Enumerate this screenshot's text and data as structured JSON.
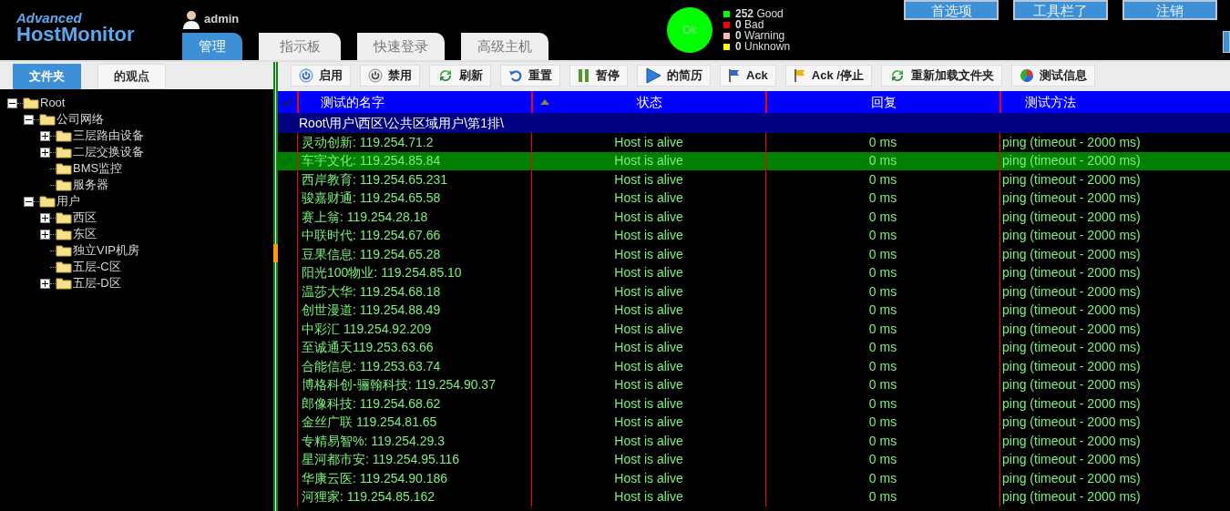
{
  "logo": {
    "line1": "Advanced",
    "line2": "HostMonitor"
  },
  "user": "admin",
  "tabs": [
    {
      "label": "管理",
      "selected": true
    },
    {
      "label": "指示板",
      "selected": false
    },
    {
      "label": "快速登录",
      "selected": false
    },
    {
      "label": "高级主机",
      "selected": false
    }
  ],
  "status_light": {
    "label": "Ok",
    "color": "#00ff00"
  },
  "summary": [
    {
      "count": "252",
      "label": "Good",
      "color": "#00ff00"
    },
    {
      "count": "0",
      "label": "Bad",
      "color": "#ff0000"
    },
    {
      "count": "0",
      "label": "Warning",
      "color": "#ffb6b6"
    },
    {
      "count": "0",
      "label": "Unknown",
      "color": "#ffff00"
    }
  ],
  "top_buttons": [
    "首选项",
    "工具栏了",
    "注销"
  ],
  "side_tabs": [
    {
      "label": "文件夹",
      "selected": true
    },
    {
      "label": "的观点",
      "selected": false
    }
  ],
  "toolbar": [
    {
      "label": "启用",
      "kind": "power"
    },
    {
      "label": "禁用",
      "kind": "power-off"
    },
    {
      "label": "刷新",
      "kind": "refresh"
    },
    {
      "label": "重置",
      "kind": "reset"
    },
    {
      "label": "暂停",
      "kind": "pause"
    },
    {
      "label": "的简历",
      "kind": "play"
    },
    {
      "label": "Ack",
      "kind": "flag"
    },
    {
      "label": "Ack /停止",
      "kind": "flag-stop"
    },
    {
      "label": "重新加载文件夹",
      "kind": "refresh"
    },
    {
      "label": "测试信息",
      "kind": "info"
    }
  ],
  "tree": [
    {
      "label": "Root",
      "expanded": true,
      "children": [
        {
          "label": "公司网络",
          "expanded": true,
          "children": [
            {
              "label": "三层路由设备",
              "expanded": false
            },
            {
              "label": "二层交换设备",
              "expanded": false
            },
            {
              "label": "BMS监控"
            },
            {
              "label": "服务器"
            }
          ]
        },
        {
          "label": "用户",
          "expanded": true,
          "children": [
            {
              "label": "西区",
              "expanded": false
            },
            {
              "label": "东区",
              "expanded": false
            },
            {
              "label": "独立VIP机房"
            },
            {
              "label": "五层-C区"
            },
            {
              "label": "五层-D区",
              "expanded": false
            }
          ]
        }
      ]
    }
  ],
  "table": {
    "columns": [
      "测试的名字",
      "状态",
      "回复",
      "测试方法"
    ],
    "group": "Root\\用户\\西区\\公共区域用户\\第1排\\",
    "rows": [
      {
        "name": "灵动创新: 119.254.71.2",
        "status": "Host is alive",
        "reply": "0 ms",
        "method": "ping (timeout - 2000 ms)",
        "selected": false
      },
      {
        "name": "车宇文化: 119.254.85.84",
        "status": "Host is alive",
        "reply": "0 ms",
        "method": "ping (timeout - 2000 ms)",
        "selected": true
      },
      {
        "name": "西岸教育: 119.254.65.231",
        "status": "Host is alive",
        "reply": "0 ms",
        "method": "ping (timeout - 2000 ms)",
        "selected": false
      },
      {
        "name": "骏嘉财通: 119.254.65.58",
        "status": "Host is alive",
        "reply": "0 ms",
        "method": "ping (timeout - 2000 ms)",
        "selected": false
      },
      {
        "name": "赛上翁: 119.254.28.18",
        "status": "Host is alive",
        "reply": "0 ms",
        "method": "ping (timeout - 2000 ms)",
        "selected": false
      },
      {
        "name": "中联时代: 119.254.67.66",
        "status": "Host is alive",
        "reply": "0 ms",
        "method": "ping (timeout - 2000 ms)",
        "selected": false
      },
      {
        "name": "豆果信息: 119.254.65.28",
        "status": "Host is alive",
        "reply": "0 ms",
        "method": "ping (timeout - 2000 ms)",
        "selected": false
      },
      {
        "name": "阳光100物业: 119.254.85.10",
        "status": "Host is alive",
        "reply": "0 ms",
        "method": "ping (timeout - 2000 ms)",
        "selected": false
      },
      {
        "name": "温莎大华: 119.254.68.18",
        "status": "Host is alive",
        "reply": "0 ms",
        "method": "ping (timeout - 2000 ms)",
        "selected": false
      },
      {
        "name": "创世漫道: 119.254.88.49",
        "status": "Host is alive",
        "reply": "0 ms",
        "method": "ping (timeout - 2000 ms)",
        "selected": false
      },
      {
        "name": "中彩汇 119.254.92.209",
        "status": "Host is alive",
        "reply": "0 ms",
        "method": "ping (timeout - 2000 ms)",
        "selected": false
      },
      {
        "name": "至诚通天119.253.63.66",
        "status": "Host is alive",
        "reply": "0 ms",
        "method": "ping (timeout - 2000 ms)",
        "selected": false
      },
      {
        "name": "合能信息: 119.253.63.74",
        "status": "Host is alive",
        "reply": "0 ms",
        "method": "ping (timeout - 2000 ms)",
        "selected": false
      },
      {
        "name": "博格科创-骊翰科技: 119.254.90.37",
        "status": "Host is alive",
        "reply": "0 ms",
        "method": "ping (timeout - 2000 ms)",
        "selected": false
      },
      {
        "name": "郎像科技: 119.254.68.62",
        "status": "Host is alive",
        "reply": "0 ms",
        "method": "ping (timeout - 2000 ms)",
        "selected": false
      },
      {
        "name": "金丝广联 119.254.81.65",
        "status": "Host is alive",
        "reply": "0 ms",
        "method": "ping (timeout - 2000 ms)",
        "selected": false
      },
      {
        "name": "专精易智%: 119.254.29.3",
        "status": "Host is alive",
        "reply": "0 ms",
        "method": "ping (timeout - 2000 ms)",
        "selected": false
      },
      {
        "name": "星河都市安: 119.254.95.116",
        "status": "Host is alive",
        "reply": "0 ms",
        "method": "ping (timeout - 2000 ms)",
        "selected": false
      },
      {
        "name": "华康云医: 119.254.90.186",
        "status": "Host is alive",
        "reply": "0 ms",
        "method": "ping (timeout - 2000 ms)",
        "selected": false
      },
      {
        "name": "河狸家: 119.254.85.162",
        "status": "Host is alive",
        "reply": "0 ms",
        "method": "ping (timeout - 2000 ms)",
        "selected": false
      }
    ]
  }
}
